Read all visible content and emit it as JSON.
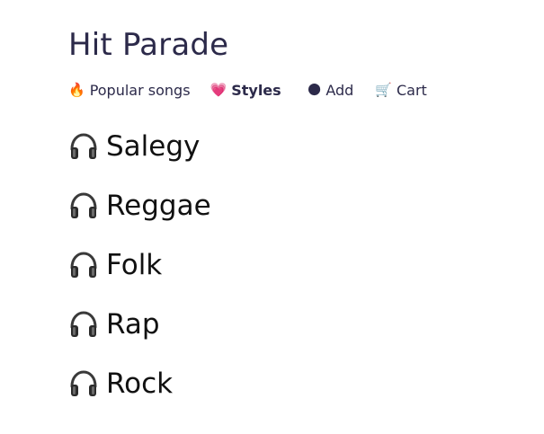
{
  "app": {
    "title": "Hit Parade"
  },
  "nav": {
    "items": [
      {
        "icon": "fire-icon",
        "emoji": "🔥",
        "label": "Popular songs",
        "active": false
      },
      {
        "icon": "heart-icon",
        "emoji": "💗",
        "label": "Styles",
        "active": true
      },
      {
        "icon": "dark-circle-icon",
        "emoji": "🌑",
        "label": "Add",
        "active": false
      },
      {
        "icon": "cart-icon",
        "emoji": "🛒",
        "label": "Cart",
        "active": false
      }
    ]
  },
  "styles": {
    "icon": "headphones-icon",
    "items": [
      {
        "label": "Salegy"
      },
      {
        "label": "Reggae"
      },
      {
        "label": "Folk"
      },
      {
        "label": "Rap"
      },
      {
        "label": "Rock"
      }
    ]
  }
}
